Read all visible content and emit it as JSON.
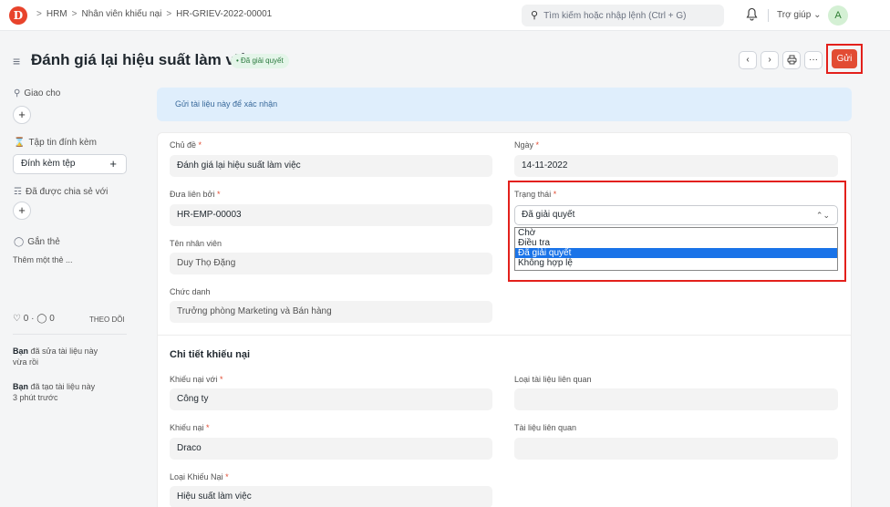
{
  "navbar": {
    "logo": "D",
    "breadcrumbs": [
      "HRM",
      "Nhân viên khiếu nại",
      "HR-GRIEV-2022-00001"
    ],
    "breadcrumb_sep": ">",
    "search_placeholder": "Tìm kiếm hoặc nhập lệnh (Ctrl + G)",
    "help_label": "Trợ giúp",
    "avatar_initial": "A"
  },
  "header": {
    "title": "Đánh giá lại hiệu suất làm việc",
    "status": "Đã giải quyết",
    "submit_label": "Gửi",
    "more_label": "···"
  },
  "sidebar": {
    "assign_label": "Giao cho",
    "attachments_label": "Tập tin đính kèm",
    "attach_button": "Đính kèm tệp",
    "shared_label": "Đã được chia sẻ với",
    "tags_label": "Gắn thẻ",
    "add_tag": "Thêm một thẻ ...",
    "likes": "0",
    "comments": "0",
    "follow_label": "THEO DÕI",
    "activity": [
      {
        "actor": "Bạn",
        "text": "đã sửa tài liệu này",
        "time": "vừa rồi"
      },
      {
        "actor": "Bạn",
        "text": "đã tạo tài liệu này",
        "time": "3 phút trước"
      }
    ]
  },
  "banner": "Gửi tài liệu này để xác nhận",
  "form": {
    "subject": {
      "label": "Chủ đề",
      "value": "Đánh giá lại hiệu suất làm việc"
    },
    "date": {
      "label": "Ngày",
      "value": "14-11-2022"
    },
    "raised_by": {
      "label": "Đưa liên bởi",
      "value": "HR-EMP-00003"
    },
    "status": {
      "label": "Trạng thái",
      "value": "Đã giải quyết",
      "options": [
        "Chờ",
        "Điều tra",
        "Đã giải quyết",
        "Không hợp lệ"
      ],
      "selected_index": 2
    },
    "employee_name": {
      "label": "Tên nhân viên",
      "value": "Duy Thọ Đặng"
    },
    "designation": {
      "label": "Chức danh",
      "value": "Trưởng phòng Marketing và Bán hàng"
    },
    "section_title": "Chi tiết khiếu nại",
    "grievance_against_party": {
      "label": "Khiếu nại với",
      "value": "Công ty"
    },
    "associated_doctype": {
      "label": "Loại tài liệu liên quan",
      "value": ""
    },
    "grievance_against": {
      "label": "Khiếu nại",
      "value": "Draco"
    },
    "associated_document": {
      "label": "Tài liệu liên quan",
      "value": ""
    },
    "grievance_type": {
      "label": "Loại Khiếu Nại",
      "value": "Hiệu suất làm việc"
    }
  },
  "colors": {
    "accent": "#e24c33",
    "highlight": "#e3201b",
    "selected_option": "#1a73e8"
  }
}
